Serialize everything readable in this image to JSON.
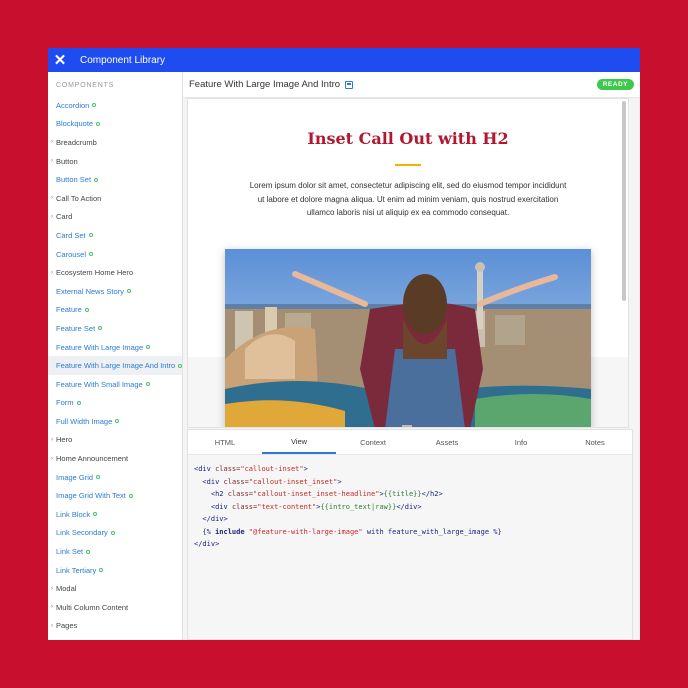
{
  "app": {
    "title": "Component Library",
    "close_glyph": "✕"
  },
  "sidebar": {
    "heading": "COMPONENTS",
    "items": [
      {
        "label": "Accordion",
        "type": "link",
        "status": true
      },
      {
        "label": "Blockquote",
        "type": "link",
        "status": true
      },
      {
        "label": "Breadcrumb",
        "type": "group"
      },
      {
        "label": "Button",
        "type": "group"
      },
      {
        "label": "Button Set",
        "type": "link",
        "status": true
      },
      {
        "label": "Call To Action",
        "type": "group"
      },
      {
        "label": "Card",
        "type": "group"
      },
      {
        "label": "Card Set",
        "type": "link",
        "status": true
      },
      {
        "label": "Carousel",
        "type": "link",
        "status": true
      },
      {
        "label": "Ecosystem Home Hero",
        "type": "group"
      },
      {
        "label": "External News Story",
        "type": "link",
        "status": true
      },
      {
        "label": "Feature",
        "type": "link",
        "status": true
      },
      {
        "label": "Feature Set",
        "type": "link",
        "status": true
      },
      {
        "label": "Feature With Large Image",
        "type": "link",
        "status": true
      },
      {
        "label": "Feature With Large Image And Intro",
        "type": "link",
        "status": true,
        "selected": true
      },
      {
        "label": "Feature With Small Image",
        "type": "link",
        "status": true
      },
      {
        "label": "Form",
        "type": "link",
        "status": true
      },
      {
        "label": "Full Width Image",
        "type": "link",
        "status": true
      },
      {
        "label": "Hero",
        "type": "group"
      },
      {
        "label": "Home Announcement",
        "type": "group"
      },
      {
        "label": "Image Grid",
        "type": "link",
        "status": true
      },
      {
        "label": "Image Grid With Text",
        "type": "link",
        "status": true
      },
      {
        "label": "Link Block",
        "type": "link",
        "status": true
      },
      {
        "label": "Link Secondary",
        "type": "link",
        "status": true
      },
      {
        "label": "Link Set",
        "type": "link",
        "status": true
      },
      {
        "label": "Link Tertiary",
        "type": "link",
        "status": true
      },
      {
        "label": "Modal",
        "type": "group"
      },
      {
        "label": "Multi Column Content",
        "type": "group"
      },
      {
        "label": "Pages",
        "type": "group"
      }
    ]
  },
  "main": {
    "component_title": "Feature With Large Image And Intro",
    "status_badge": "READY"
  },
  "preview": {
    "heading": "Inset Call Out with H2",
    "intro_text": "Lorem ipsum dolor sit amet, consectetur adipiscing elit, sed do eiusmod tempor incididunt ut labore et dolore magna aliqua. Ut enim ad minim veniam, quis nostrud exercitation ullamco laboris nisi ut aliquip ex ea commodo consequat."
  },
  "tabs": [
    "HTML",
    "View",
    "Context",
    "Assets",
    "Info",
    "Notes"
  ],
  "active_tab": "View",
  "code": {
    "l1_open": "<div ",
    "l1_attr": "class=",
    "l1_str": "\"callout-inset\"",
    "l1_close": ">",
    "l2_open": "  <div ",
    "l2_attr": "class=",
    "l2_str": "\"callout-inset_inset\"",
    "l2_close": ">",
    "l3_open": "    <h2 ",
    "l3_attr": "class=",
    "l3_str": "\"callout-inset_inset-headline\"",
    "l3_gt": ">",
    "l3_twig": "{{title}}",
    "l3_close": "</h2>",
    "l4_open": "    <div ",
    "l4_attr": "class=",
    "l4_str": "\"text-content\"",
    "l4_gt": ">",
    "l4_twig": "{{intro_text|raw}}",
    "l4_close": "</div>",
    "l5": "  </div>",
    "l6_open": "  {% ",
    "l6_kw": "include",
    "l6_str": " \"@feature-with-large-image\"",
    "l6_rest": " with feature_with_large_image %}",
    "l7": "</div>"
  },
  "colors": {
    "accent": "#1f4cf0",
    "background": "#c8102e",
    "ready": "#3ec94a",
    "heading": "#b0182f",
    "link": "#2b7bd6"
  }
}
